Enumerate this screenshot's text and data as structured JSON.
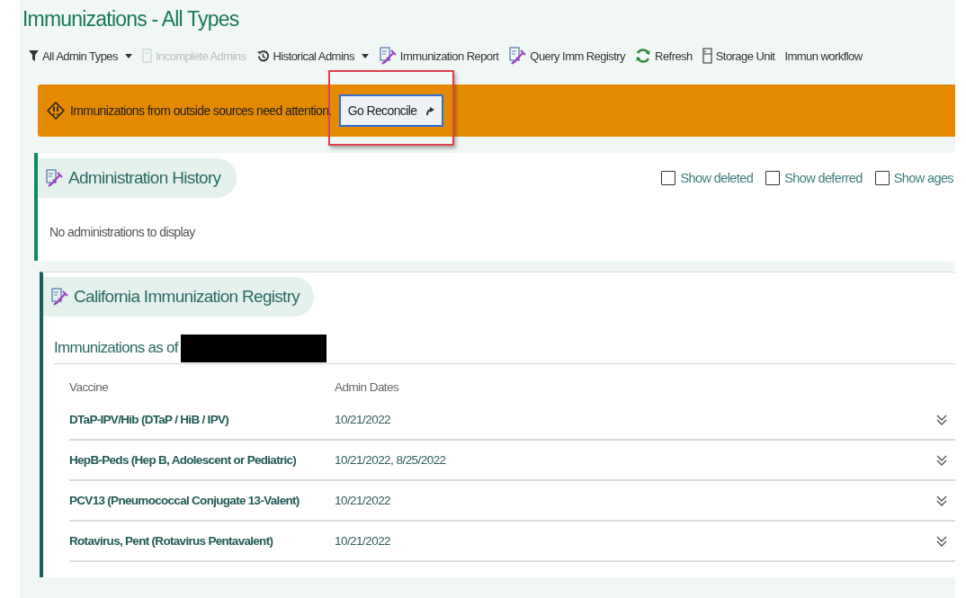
{
  "title": "Immunizations - All Types",
  "toolbar": [
    {
      "label": "All Admin Types",
      "dropdown": true,
      "disabled": false
    },
    {
      "label": "Incomplete Admins",
      "dropdown": false,
      "disabled": true
    },
    {
      "label": "Historical Admins",
      "dropdown": true,
      "disabled": false
    },
    {
      "label": "Immunization Report",
      "dropdown": false,
      "disabled": false
    },
    {
      "label": "Query Imm Registry",
      "dropdown": false,
      "disabled": false
    },
    {
      "label": "Refresh",
      "dropdown": false,
      "disabled": false
    },
    {
      "label": "Storage Unit",
      "dropdown": false,
      "disabled": false
    },
    {
      "label": "Immun workflow",
      "dropdown": false,
      "disabled": false
    }
  ],
  "alert": {
    "message": "Immunizations from outside sources need attention.",
    "button": "Go Reconcile"
  },
  "administration_history": {
    "title": "Administration History",
    "options": [
      {
        "label": "Show deleted",
        "checked": false
      },
      {
        "label": "Show deferred",
        "checked": false
      },
      {
        "label": "Show ages",
        "checked": false
      }
    ],
    "empty_message": "No administrations to display"
  },
  "registry": {
    "title": "California Immunization Registry",
    "as_of_label": "Immunizations as of",
    "columns": [
      "Vaccine",
      "Admin Dates"
    ],
    "rows": [
      {
        "vaccine": "DTaP-IPV/Hib (DTaP / HiB / IPV)",
        "dates": "10/21/2022",
        "expanded": false
      },
      {
        "vaccine": "HepB-Peds (Hep B, Adolescent or Pediatric)",
        "dates": "10/21/2022, 8/25/2022",
        "expanded": false
      },
      {
        "vaccine": "PCV13 (Pneumococcal Conjugate 13-Valent)",
        "dates": "10/21/2022",
        "expanded": false
      },
      {
        "vaccine": "Rotavirus, Pent (Rotavirus Pentavalent)",
        "dates": "10/21/2022",
        "expanded": false
      }
    ]
  }
}
